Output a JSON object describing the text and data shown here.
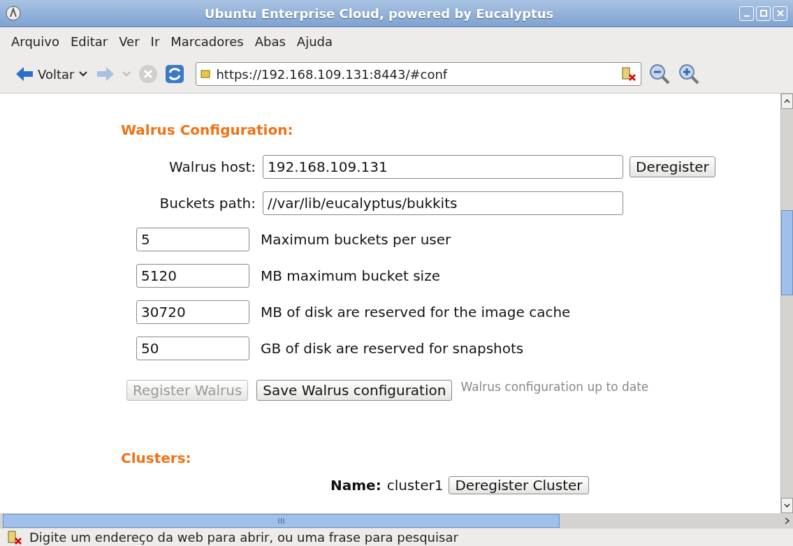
{
  "window": {
    "title": "Ubuntu Enterprise Cloud, powered by Eucalyptus"
  },
  "menu": [
    "Arquivo",
    "Editar",
    "Ver",
    "Ir",
    "Marcadores",
    "Abas",
    "Ajuda"
  ],
  "toolbar": {
    "back_label": "Voltar",
    "forward_disabled": true,
    "stop_disabled": true,
    "url": "https://192.168.109.131:8443/#conf"
  },
  "walrus": {
    "heading": "Walrus Configuration:",
    "host": {
      "label": "Walrus host:",
      "value": "192.168.109.131",
      "button": "Deregister"
    },
    "path": {
      "label": "Buckets path:",
      "value": "//var/lib/eucalyptus/bukkits"
    },
    "settings": [
      {
        "value": "5",
        "label": "Maximum buckets per user"
      },
      {
        "value": "5120",
        "label": "MB maximum bucket size"
      },
      {
        "value": "30720",
        "label": "MB of disk are reserved for the image cache"
      },
      {
        "value": "50",
        "label": "GB of disk are reserved for snapshots"
      }
    ],
    "buttons": [
      {
        "label": "Register Walrus",
        "disabled": true
      },
      {
        "label": "Save Walrus configuration",
        "disabled": false
      }
    ],
    "status": "Walrus configuration up to date"
  },
  "clusters": {
    "heading": "Clusters:",
    "name_label": "Name:",
    "name": "cluster1",
    "button": "Deregister Cluster"
  },
  "status_bar": "Digite um endereço da web para abrir, ou uma frase para pesquisar"
}
